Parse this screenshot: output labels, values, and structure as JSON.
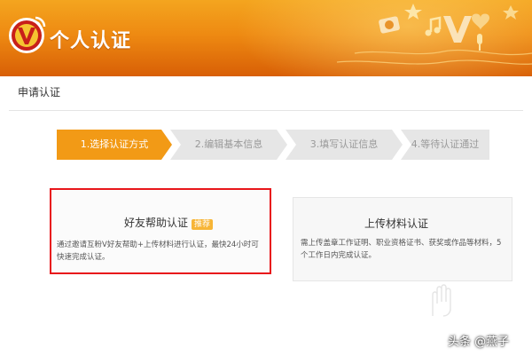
{
  "header": {
    "title": "个人认证",
    "logo_letter": "V"
  },
  "section": {
    "title": "申请认证"
  },
  "steps": [
    {
      "label": "1.选择认证方式",
      "active": true
    },
    {
      "label": "2.编辑基本信息",
      "active": false
    },
    {
      "label": "3.填写认证信息",
      "active": false
    },
    {
      "label": "4.等待认证通过",
      "active": false
    }
  ],
  "cards": {
    "friend": {
      "title": "好友帮助认证",
      "badge": "推荐",
      "desc": "通过邀请互粉V好友帮助+上传材料进行认证，最快24小时可快速完成认证。"
    },
    "upload": {
      "title": "上传材料认证",
      "desc": "需上传盖章工作证明、职业资格证书、获奖或作品等材料，5个工作日内完成认证。"
    }
  },
  "watermark": "头条 @燕子",
  "colors": {
    "header_top": "#f4a51f",
    "header_bottom": "#d85f06",
    "step_active": "#f29a16",
    "step_inactive": "#e6e6e6",
    "highlight_border": "#e8161b",
    "badge": "#f7b536"
  },
  "icons": [
    "v-logo-icon",
    "camera-icon",
    "music-note-icon",
    "star-icon",
    "heart-icon",
    "microphone-icon"
  ]
}
